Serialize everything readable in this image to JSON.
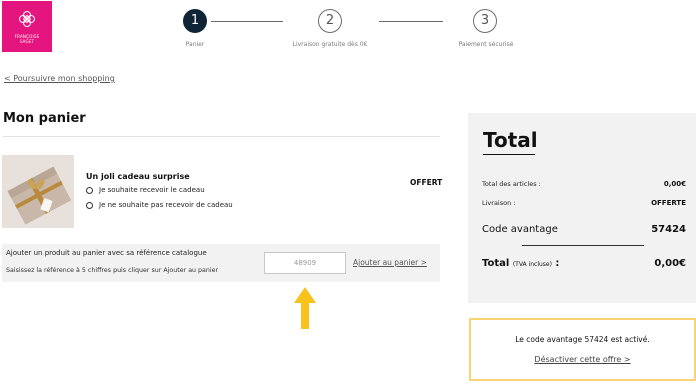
{
  "brand": {
    "line1": "FRANÇOISE",
    "line2": "SAGET"
  },
  "stepper": {
    "steps": [
      {
        "number": "1",
        "label": "Panier"
      },
      {
        "number": "2",
        "label": "Livraison gratuite dès 0€"
      },
      {
        "number": "3",
        "label": "Paiement sécurisé"
      }
    ]
  },
  "back_link": "< Poursuivre mon shopping",
  "cart": {
    "title": "Mon panier",
    "product": {
      "name": "Un joli cadeau surprise",
      "price": "OFFERT",
      "options": [
        "Je souhaite recevoir le cadeau",
        "Je ne souhaite pas recevoir de cadeau"
      ]
    },
    "reference": {
      "title": "Ajouter un produit au panier avec sa référence catalogue",
      "subtitle": "Saisissez la référence à 5 chiffres puis cliquer sur Ajouter au panier",
      "input_placeholder": "48909",
      "button": "Ajouter au panier >"
    }
  },
  "summary": {
    "title": "Total",
    "items_label": "Total des articles :",
    "items_value": "0,00€",
    "shipping_label": "Livraison :",
    "shipping_value": "OFFERTE",
    "code_label": "Code avantage",
    "code_value": "57424",
    "total_label": "Total",
    "total_note": "(TVA incluse)",
    "total_colon": " :",
    "total_value": "0,00€"
  },
  "promo": {
    "message": "Le code avantage 57424 est activé.",
    "link": "Désactiver cette offre >"
  },
  "colors": {
    "brand_pink": "#e5157f",
    "step_active": "#0f2536",
    "annotation_arrow": "#f7c21c",
    "promo_border": "#f7d574",
    "panel_bg": "#f2f2f2"
  },
  "icons": {
    "logo": "flower-logo-icon",
    "arrow": "arrow-up-icon"
  }
}
